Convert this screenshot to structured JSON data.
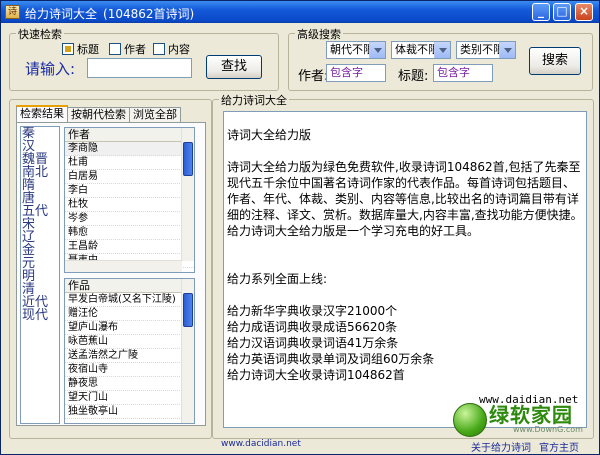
{
  "window": {
    "title": "给力诗词大全",
    "count": "(104862首诗词)",
    "app_icon": "诗"
  },
  "quick_search": {
    "group_label": "快速检索",
    "options": [
      {
        "label": "标题",
        "checked": true
      },
      {
        "label": "作者",
        "checked": false
      },
      {
        "label": "内容",
        "checked": false
      }
    ],
    "input_label": "请输入:",
    "input_value": "",
    "search_button": "查找"
  },
  "advanced_search": {
    "group_label": "高级搜索",
    "dropdowns": [
      "朝代不限",
      "体裁不限",
      "类别不限"
    ],
    "author_label": "作者:",
    "author_placeholder": "包含字",
    "title_label": "标题:",
    "title_placeholder": "包含字",
    "search_button": "搜索"
  },
  "tabs": [
    "检索结果",
    "按朝代检索",
    "浏览全部"
  ],
  "dynasties": [
    "秦",
    "汉",
    "魏晋",
    "南北",
    "隋",
    "唐",
    "五代",
    "宋",
    "辽",
    "金",
    "元",
    "明",
    "清",
    "近代",
    "现代"
  ],
  "authors": {
    "header": "作者",
    "rows": [
      "李商隐",
      "杜甫",
      "白居易",
      "李白",
      "杜牧",
      "岑参",
      "韩愈",
      "王昌龄",
      "聂夷中"
    ]
  },
  "works": {
    "header": "作品",
    "rows": [
      "早发白帝城(又名下江陵)",
      "赠汪伦",
      "望庐山瀑布",
      "咏芭蕉山",
      "送孟浩然之广陵",
      "夜宿山寺",
      "静夜思",
      "望天门山",
      "独坐敬亭山"
    ]
  },
  "content": {
    "group_label": "给力诗词大全",
    "heading": "诗词大全给力版",
    "paragraph1": "诗词大全给力版为绿色免费软件,收录诗词104862首,包括了先秦至现代五千余位中国著名诗词作家的代表作品。每首诗词包括题目、作者、年代、体裁、类别、内容等信息,比较出名的诗词篇目带有详细的注释、译文、赏析。数据库量大,内容丰富,查找功能方便快捷。给力诗词大全给力版是一个学习充电的好工具。",
    "series_title": "给力系列全面上线:",
    "series": [
      "给力新华字典收录汉字21000个",
      "给力成语词典收录成语56620条",
      "给力汉语词典收录词语41万余条",
      "给力英语词典收录单词及词组60万余条",
      "给力诗词大全收录诗词104862首"
    ],
    "site_url": "www.daidian.net"
  },
  "watermark": {
    "text": "绿软家园",
    "sub": "www.DownG.com"
  },
  "footer": {
    "site": "www.dacidian.net",
    "about": "关于给力诗词",
    "official": "官方主页"
  }
}
